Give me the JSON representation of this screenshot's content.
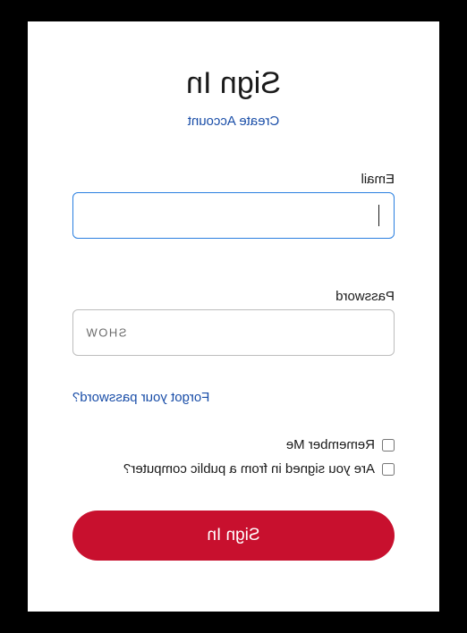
{
  "title": "Sign In",
  "create_account_link": "Create Account",
  "fields": {
    "email": {
      "label": "Email",
      "value": ""
    },
    "password": {
      "label": "Password",
      "value": "",
      "show_toggle": "SHOW"
    }
  },
  "forgot_password_link": "Forgot your password?",
  "checkboxes": {
    "remember_me": "Remember Me",
    "public_computer": "Are you signed in from a public computer?"
  },
  "submit_button": "Sign In",
  "colors": {
    "primary_button": "#c8102e",
    "link": "#1a4ea8",
    "focus_border": "#2a7fe0"
  }
}
